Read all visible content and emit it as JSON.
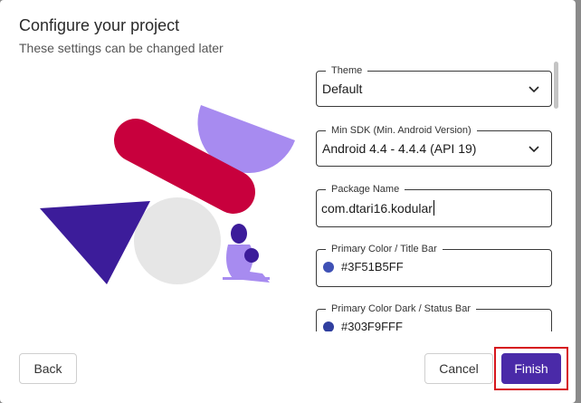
{
  "dialog": {
    "title": "Configure your project",
    "subtitle": "These settings can be changed later"
  },
  "form": {
    "theme": {
      "label": "Theme",
      "value": "Default"
    },
    "min_sdk": {
      "label": "Min SDK (Min. Android Version)",
      "value": "Android 4.4 - 4.4.4 (API 19)"
    },
    "package_name": {
      "label": "Package Name",
      "value": "com.dtari16.kodular"
    },
    "primary_color": {
      "label": "Primary Color / Title Bar",
      "value": "#3F51B5FF",
      "swatch": "#3F51B5"
    },
    "primary_color_dark": {
      "label": "Primary Color Dark / Status Bar",
      "value": "#303F9FFF",
      "swatch": "#303F9F"
    }
  },
  "buttons": {
    "back": "Back",
    "cancel": "Cancel",
    "finish": "Finish"
  },
  "colors": {
    "accent": "#4A2AA8",
    "illustration_red": "#C8003D",
    "illustration_lavender": "#A78BF0",
    "illustration_indigo": "#3C1C9A",
    "illustration_grey": "#E6E6E6",
    "highlight": "#D6161D"
  }
}
